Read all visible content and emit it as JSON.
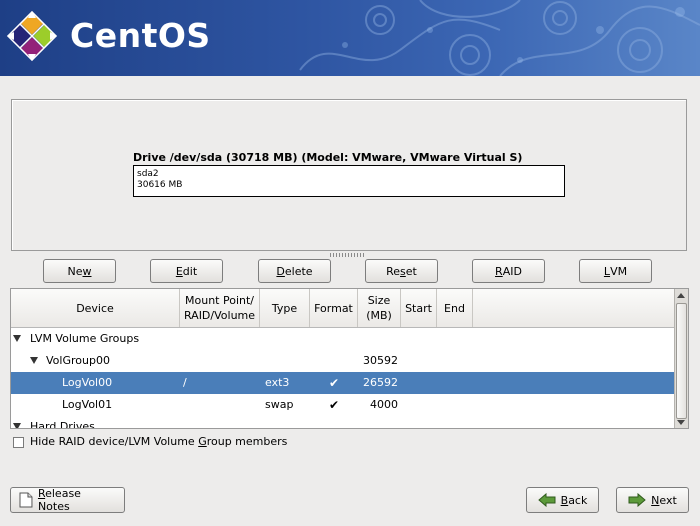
{
  "banner": {
    "logo_text": "CentOS"
  },
  "drive": {
    "title": "Drive /dev/sda (30718 MB) (Model: VMware, VMware Virtual S)",
    "partition_name": "sda2",
    "partition_size": "30616 MB"
  },
  "actions": [
    {
      "pre": "Ne",
      "key": "w",
      "post": ""
    },
    {
      "pre": "",
      "key": "E",
      "post": "dit"
    },
    {
      "pre": "",
      "key": "D",
      "post": "elete"
    },
    {
      "pre": "Re",
      "key": "s",
      "post": "et"
    },
    {
      "pre": "",
      "key": "R",
      "post": "AID"
    },
    {
      "pre": "",
      "key": "L",
      "post": "VM"
    }
  ],
  "table": {
    "headers": {
      "device": "Device",
      "mount_line1": "Mount Point/",
      "mount_line2": "RAID/Volume",
      "type": "Type",
      "format": "Format",
      "size_line1": "Size",
      "size_line2": "(MB)",
      "start": "Start",
      "end": "End"
    },
    "rows": [
      {
        "device": "LVM Volume Groups",
        "mount": "",
        "type": "",
        "format": "",
        "size": ""
      },
      {
        "device": "VolGroup00",
        "mount": "",
        "type": "",
        "format": "",
        "size": "30592"
      },
      {
        "device": "LogVol00",
        "mount": "/",
        "type": "ext3",
        "format": "✔",
        "size": "26592"
      },
      {
        "device": "LogVol01",
        "mount": "",
        "type": "swap",
        "format": "✔",
        "size": "4000"
      },
      {
        "device": "Hard Drives",
        "mount": "",
        "type": "",
        "format": "",
        "size": ""
      }
    ]
  },
  "hide_option": {
    "pre": "Hide RAID device/LVM Volume ",
    "key": "G",
    "post": "roup members"
  },
  "footer": {
    "release_notes": {
      "pre": "",
      "key": "R",
      "post": "elease Notes"
    },
    "back": {
      "pre": "",
      "key": "B",
      "post": "ack"
    },
    "next": {
      "pre": "",
      "key": "N",
      "post": "ext"
    }
  },
  "colors": {
    "selection": "#4a7eb9",
    "banner": "#2f56a3"
  }
}
